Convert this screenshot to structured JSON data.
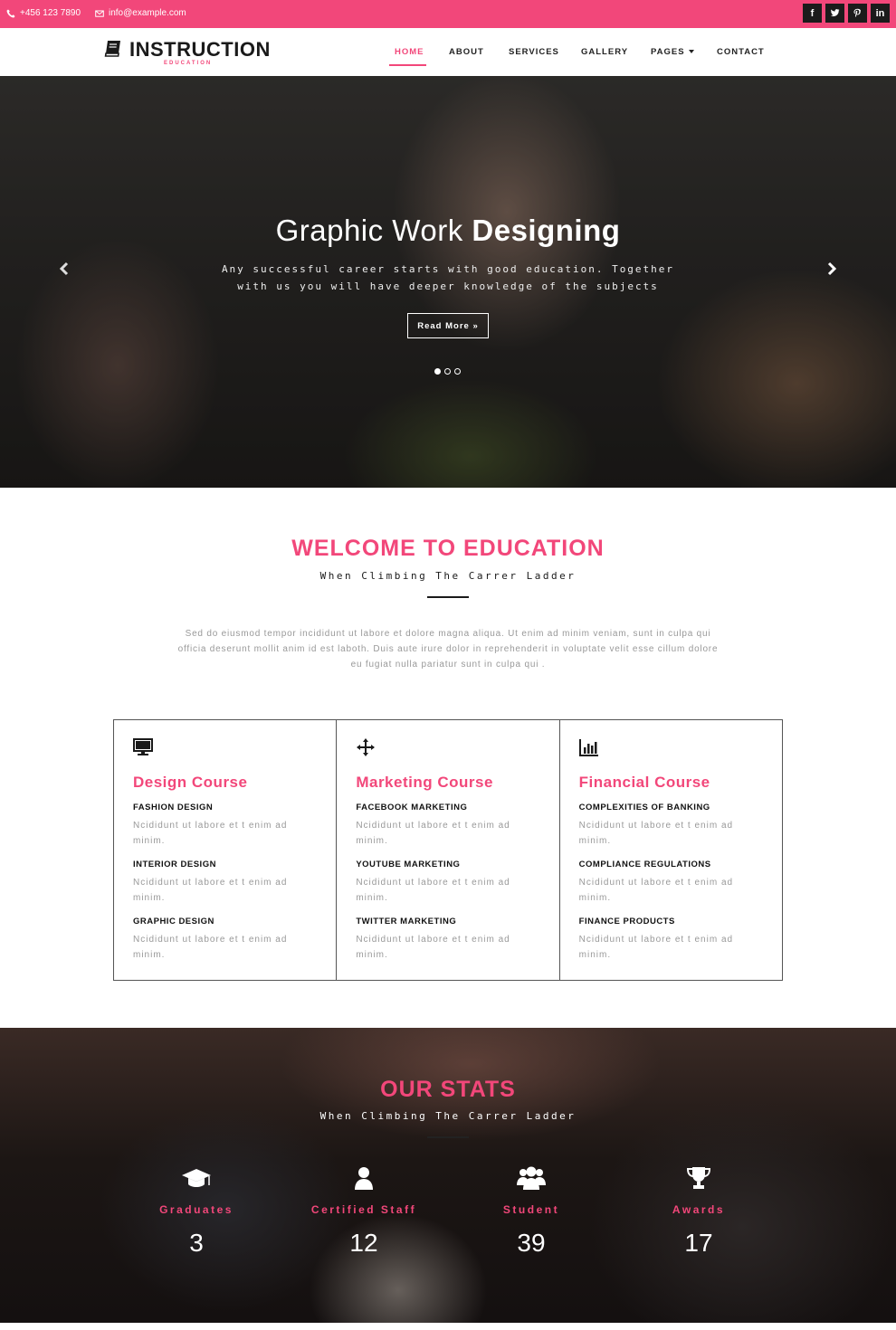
{
  "topbar": {
    "phone": "+456 123 7890",
    "email": "info@example.com",
    "social": [
      {
        "icon": "facebook-icon",
        "glyph": "f"
      },
      {
        "icon": "twitter-icon",
        "glyph": "t"
      },
      {
        "icon": "pinterest-icon",
        "glyph": "p"
      },
      {
        "icon": "linkedin-icon",
        "glyph": "in"
      }
    ]
  },
  "brand": {
    "name": "INSTRUCTION",
    "tagline": "EDUCATION",
    "accent": "#f2477a"
  },
  "nav": {
    "items": [
      {
        "label": "HOME",
        "active": true
      },
      {
        "label": "ABOUT"
      },
      {
        "label": "SERVICES"
      },
      {
        "label": "GALLERY"
      },
      {
        "label": "PAGES"
      },
      {
        "label": "CONTACT"
      }
    ]
  },
  "hero": {
    "title_light": "Graphic Work",
    "title_bold": "Designing",
    "text": "Any successful career starts with good education. Together with us you will have deeper knowledge of the subjects",
    "button": "Read More »",
    "active_slide": 1,
    "slide_count": 3
  },
  "welcome": {
    "title": "WELCOME TO EDUCATION",
    "subtitle": "When Climbing The Carrer Ladder",
    "text": "Sed do eiusmod tempor incididunt ut labore et dolore magna aliqua. Ut enim ad minim veniam, sunt in culpa qui officia deserunt mollit anim id est laboth. Duis aute irure dolor in reprehenderit in voluptate velit esse cillum dolore eu fugiat nulla pariatur sunt in culpa qui ."
  },
  "courses": [
    {
      "icon": "monitor-icon",
      "title": "Design Course",
      "items": [
        {
          "name": "FASHION DESIGN",
          "text": "Ncididunt ut labore et t enim ad minim."
        },
        {
          "name": "INTERIOR DESIGN",
          "text": "Ncididunt ut labore et t enim ad minim."
        },
        {
          "name": "GRAPHIC DESIGN",
          "text": "Ncididunt ut labore et t enim ad minim."
        }
      ]
    },
    {
      "icon": "move-arrows-icon",
      "title": "Marketing Course",
      "items": [
        {
          "name": "FACEBOOK MARKETING",
          "text": "Ncididunt ut labore et t enim ad minim."
        },
        {
          "name": "YOUTUBE MARKETING",
          "text": "Ncididunt ut labore et t enim ad minim."
        },
        {
          "name": "TWITTER MARKETING",
          "text": "Ncididunt ut labore et t enim ad minim."
        }
      ]
    },
    {
      "icon": "bar-chart-icon",
      "title": "Financial Course",
      "items": [
        {
          "name": "COMPLEXITIES OF BANKING",
          "text": "Ncididunt ut labore et t enim ad minim."
        },
        {
          "name": "COMPLIANCE REGULATIONS",
          "text": "Ncididunt ut labore et t enim ad minim."
        },
        {
          "name": "FINANCE PRODUCTS",
          "text": "Ncididunt ut labore et t enim ad minim."
        }
      ]
    }
  ],
  "stats": {
    "title": "OUR STATS",
    "subtitle": "When Climbing The Carrer Ladder",
    "items": [
      {
        "icon": "graduation-cap-icon",
        "label": "Graduates",
        "value": "3"
      },
      {
        "icon": "user-icon",
        "label": "Certified Staff",
        "value": "12"
      },
      {
        "icon": "users-icon",
        "label": "Student",
        "value": "39"
      },
      {
        "icon": "trophy-icon",
        "label": "Awards",
        "value": "17"
      }
    ]
  }
}
